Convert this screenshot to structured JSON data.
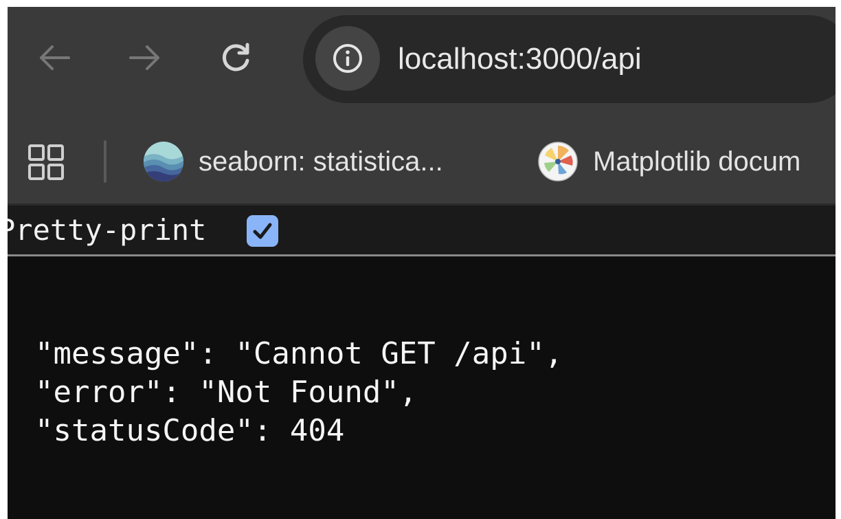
{
  "browser": {
    "url": "localhost:3000/api",
    "nav": {
      "back_icon": "arrow-left-icon",
      "forward_icon": "arrow-right-icon",
      "reload_icon": "reload-icon",
      "info_icon": "info-icon"
    },
    "bookmarks": [
      {
        "label": "seaborn: statistica...",
        "icon": "seaborn-logo-icon"
      },
      {
        "label": "Matplotlib docum",
        "icon": "matplotlib-logo-icon"
      }
    ]
  },
  "viewer": {
    "pretty_print_label": "Pretty-print",
    "pretty_print_checked": true,
    "open_brace": "{",
    "close_brace": "}",
    "lines": [
      "\"message\": \"Cannot GET /api\",",
      "\"error\": \"Not Found\",",
      "\"statusCode\": 404"
    ]
  },
  "colors": {
    "toolbar_bg": "#3a3a3a",
    "omnibox_bg": "#282828",
    "content_bg": "#0e0e0e",
    "checkbox_accent": "#8ab4f8"
  }
}
